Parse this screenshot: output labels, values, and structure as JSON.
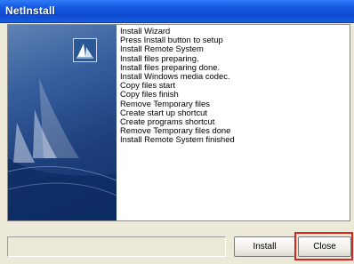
{
  "window": {
    "title": "NetInstall"
  },
  "banner": {
    "logo_icon": "netinstall-logo-icon",
    "background_icon": "sailboat-graphic-icon"
  },
  "log": {
    "lines": [
      "Install Wizard",
      "Press Install button to setup",
      "Install Remote System",
      "Install files preparing.",
      "Install files preparing done.",
      "Install Windows media codec.",
      "Copy files start",
      "Copy files finish",
      "Remove Temporary files",
      "Create start up shortcut",
      "Create programs shortcut",
      "Remove Temporary files done",
      "Install Remote System finished"
    ]
  },
  "status": {
    "text": ""
  },
  "buttons": {
    "install_label": "Install",
    "close_label": "Close"
  },
  "colors": {
    "titlebar": "#0f4bd0",
    "highlight": "#e0241b",
    "face": "#ece9d8"
  }
}
